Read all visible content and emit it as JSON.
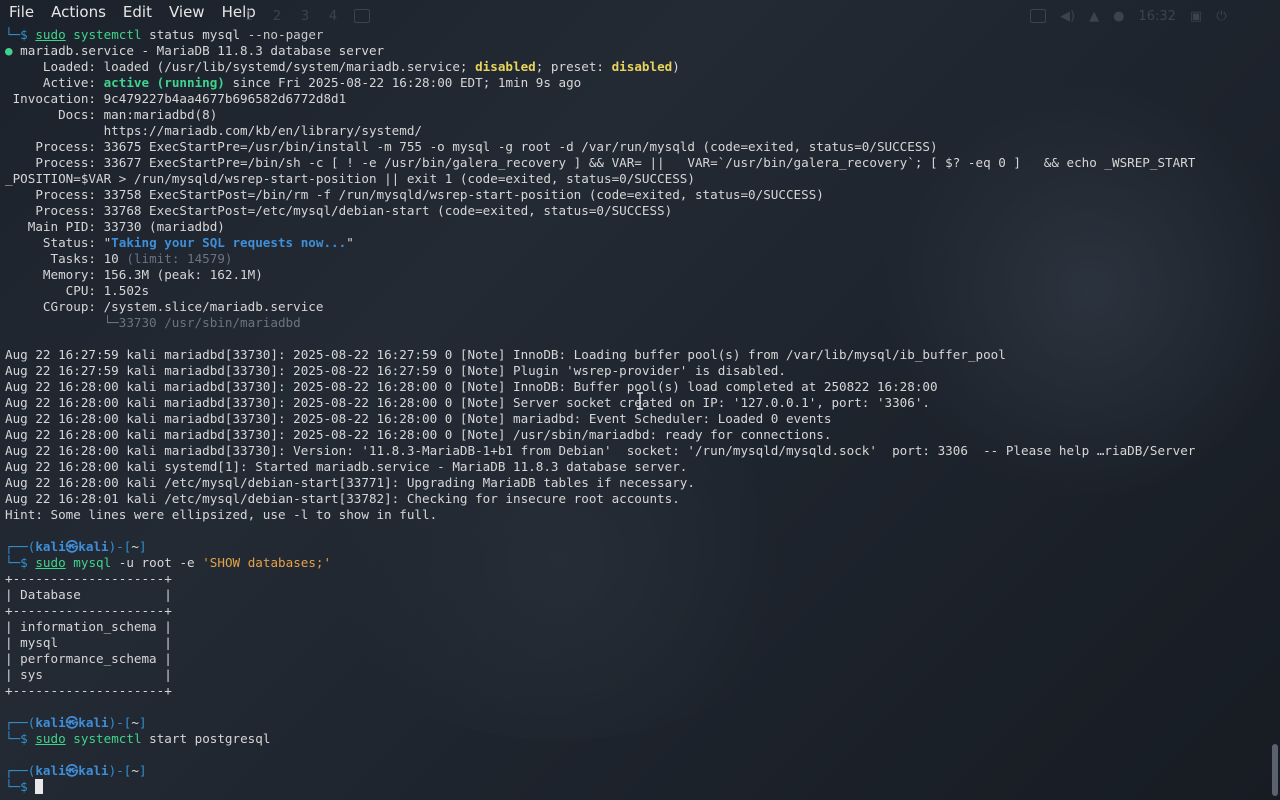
{
  "menu": [
    "File",
    "Actions",
    "Edit",
    "View",
    "Help"
  ],
  "workspaces": [
    "1",
    "2",
    "3",
    "4"
  ],
  "clock": "16:32",
  "lines": [
    [
      {
        "t": "└─$ ",
        "c": "promptc"
      },
      {
        "t": "sudo",
        "c": "cmdname ul"
      },
      {
        "t": " "
      },
      {
        "t": "systemctl",
        "c": "cmdname"
      },
      {
        "t": " status mysql "
      },
      {
        "t": "--no-pager",
        "c": "flag"
      }
    ],
    [
      {
        "t": "● ",
        "c": "green"
      },
      {
        "t": "mariadb.service - MariaDB 11.8.3 database server"
      }
    ],
    [
      {
        "t": "     Loaded: loaded (/usr/lib/systemd/system/mariadb.service; "
      },
      {
        "t": "disabled",
        "c": "yellow"
      },
      {
        "t": "; preset: "
      },
      {
        "t": "disabled",
        "c": "yellow"
      },
      {
        "t": ")"
      }
    ],
    [
      {
        "t": "     Active: "
      },
      {
        "t": "active (running)",
        "c": "greenbold"
      },
      {
        "t": " since Fri 2025-08-22 16:28:00 EDT; 1min 9s ago"
      }
    ],
    [
      {
        "t": " Invocation: 9c479227b4aa4677b696582d6772d8d1"
      }
    ],
    [
      {
        "t": "       Docs: man:mariadbd(8)"
      }
    ],
    [
      {
        "t": "             https://mariadb.com/kb/en/library/systemd/"
      }
    ],
    [
      {
        "t": "    Process: 33675 ExecStartPre=/usr/bin/install -m 755 -o mysql -g root -d /var/run/mysqld (code=exited, status=0/SUCCESS)"
      }
    ],
    [
      {
        "t": "    Process: 33677 ExecStartPre=/bin/sh -c [ ! -e /usr/bin/galera_recovery ] && VAR= ||   VAR=`/usr/bin/galera_recovery`; [ $? -eq 0 ]   && echo _WSREP_START"
      }
    ],
    [
      {
        "t": "_POSITION=$VAR > /run/mysqld/wsrep-start-position || exit 1 (code=exited, status=0/SUCCESS)"
      }
    ],
    [
      {
        "t": "    Process: 33758 ExecStartPost=/bin/rm -f /run/mysqld/wsrep-start-position (code=exited, status=0/SUCCESS)"
      }
    ],
    [
      {
        "t": "    Process: 33768 ExecStartPost=/etc/mysql/debian-start (code=exited, status=0/SUCCESS)"
      }
    ],
    [
      {
        "t": "   Main PID: 33730 (mariadbd)"
      }
    ],
    [
      {
        "t": "     Status: \""
      },
      {
        "t": "Taking your SQL requests now...",
        "c": "bluebold"
      },
      {
        "t": "\""
      }
    ],
    [
      {
        "t": "      Tasks: 10 "
      },
      {
        "t": "(limit: 14579)",
        "c": "dim"
      }
    ],
    [
      {
        "t": "     Memory: 156.3M (peak: 162.1M)"
      }
    ],
    [
      {
        "t": "        CPU: 1.502s"
      }
    ],
    [
      {
        "t": "     CGroup: /system.slice/mariadb.service"
      }
    ],
    [
      {
        "t": "             └─33730 /usr/sbin/mariadbd",
        "c": "dim"
      }
    ],
    [
      {
        "t": ""
      }
    ],
    [
      {
        "t": "Aug 22 16:27:59 kali mariadbd[33730]: 2025-08-22 16:27:59 0 [Note] InnoDB: Loading buffer pool(s) from /var/lib/mysql/ib_buffer_pool"
      }
    ],
    [
      {
        "t": "Aug 22 16:27:59 kali mariadbd[33730]: 2025-08-22 16:27:59 0 [Note] Plugin 'wsrep-provider' is disabled."
      }
    ],
    [
      {
        "t": "Aug 22 16:28:00 kali mariadbd[33730]: 2025-08-22 16:28:00 0 [Note] InnoDB: Buffer pool(s) load completed at 250822 16:28:00"
      }
    ],
    [
      {
        "t": "Aug 22 16:28:00 kali mariadbd[33730]: 2025-08-22 16:28:00 0 [Note] Server socket created on IP: '127.0.0.1', port: '3306'."
      }
    ],
    [
      {
        "t": "Aug 22 16:28:00 kali mariadbd[33730]: 2025-08-22 16:28:00 0 [Note] mariadbd: Event Scheduler: Loaded 0 events"
      }
    ],
    [
      {
        "t": "Aug 22 16:28:00 kali mariadbd[33730]: 2025-08-22 16:28:00 0 [Note] /usr/sbin/mariadbd: ready for connections."
      }
    ],
    [
      {
        "t": "Aug 22 16:28:00 kali mariadbd[33730]: Version: '11.8.3-MariaDB-1+b1 from Debian'  socket: '/run/mysqld/mysqld.sock'  port: 3306  -- Please help …riaDB/Server"
      }
    ],
    [
      {
        "t": "Aug 22 16:28:00 kali systemd[1]: Started mariadb.service - MariaDB 11.8.3 database server."
      }
    ],
    [
      {
        "t": "Aug 22 16:28:00 kali /etc/mysql/debian-start[33771]: Upgrading MariaDB tables if necessary."
      }
    ],
    [
      {
        "t": "Aug 22 16:28:01 kali /etc/mysql/debian-start[33782]: Checking for insecure root accounts."
      }
    ],
    [
      {
        "t": "Hint: Some lines were ellipsized, use -l to show in full."
      }
    ],
    [
      {
        "t": ""
      }
    ],
    [
      {
        "t": "┌──(",
        "c": "promptc"
      },
      {
        "t": "kali㉿kali",
        "c": "promptk"
      },
      {
        "t": ")-[",
        "c": "promptc"
      },
      {
        "t": "~",
        "c": "cmd"
      },
      {
        "t": "]",
        "c": "promptc"
      }
    ],
    [
      {
        "t": "└─$ ",
        "c": "promptc"
      },
      {
        "t": "sudo",
        "c": "cmdname ul"
      },
      {
        "t": " "
      },
      {
        "t": "mysql",
        "c": "cmdname"
      },
      {
        "t": " -u root -e "
      },
      {
        "t": "'SHOW databases;'",
        "c": "orange"
      }
    ],
    [
      {
        "t": "+--------------------+"
      }
    ],
    [
      {
        "t": "| Database           |"
      }
    ],
    [
      {
        "t": "+--------------------+"
      }
    ],
    [
      {
        "t": "| information_schema |"
      }
    ],
    [
      {
        "t": "| mysql              |"
      }
    ],
    [
      {
        "t": "| performance_schema |"
      }
    ],
    [
      {
        "t": "| sys                |"
      }
    ],
    [
      {
        "t": "+--------------------+"
      }
    ],
    [
      {
        "t": ""
      }
    ],
    [
      {
        "t": "┌──(",
        "c": "promptc"
      },
      {
        "t": "kali㉿kali",
        "c": "promptk"
      },
      {
        "t": ")-[",
        "c": "promptc"
      },
      {
        "t": "~",
        "c": "cmd"
      },
      {
        "t": "]",
        "c": "promptc"
      }
    ],
    [
      {
        "t": "└─$ ",
        "c": "promptc"
      },
      {
        "t": "sudo",
        "c": "cmdname ul"
      },
      {
        "t": " "
      },
      {
        "t": "systemctl",
        "c": "cmdname"
      },
      {
        "t": " start postgresql"
      }
    ],
    [
      {
        "t": ""
      }
    ],
    [
      {
        "t": "┌──(",
        "c": "promptc"
      },
      {
        "t": "kali㉿kali",
        "c": "promptk"
      },
      {
        "t": ")-[",
        "c": "promptc"
      },
      {
        "t": "~",
        "c": "cmd"
      },
      {
        "t": "]",
        "c": "promptc"
      }
    ],
    [
      {
        "t": "└─$ ",
        "c": "promptc"
      },
      {
        "t": "",
        "c": "cursor"
      }
    ]
  ]
}
